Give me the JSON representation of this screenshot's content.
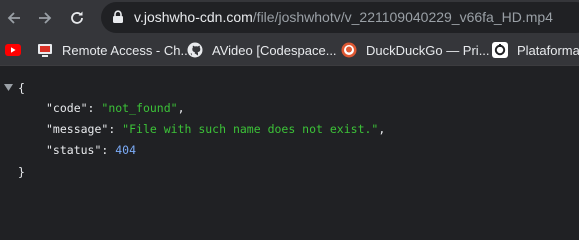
{
  "browser": {
    "url_host": "v.joshwho-cdn.com",
    "url_path": "/file/joshwhotv/v_221109040229_v66fa_HD.mp4"
  },
  "bookmarks": [
    {
      "label": "",
      "icon": "youtube-icon"
    },
    {
      "label": "Remote Access - Ch...",
      "icon": "remote-desktop-icon"
    },
    {
      "label": "AVideo [Codespace...",
      "icon": "github-icon"
    },
    {
      "label": "DuckDuckGo — Pri...",
      "icon": "duckduckgo-icon"
    },
    {
      "label": "Plataforma c",
      "icon": "plataforma-icon"
    }
  ],
  "json_view": {
    "open_brace": "{",
    "close_brace": "}",
    "fields": [
      {
        "key": "\"code\"",
        "value": "\"not_found\"",
        "type": "string",
        "suffix": ","
      },
      {
        "key": "\"message\"",
        "value": "\"File with such name does not exist.\"",
        "type": "string",
        "suffix": ","
      },
      {
        "key": "\"status\"",
        "value": "404",
        "type": "number",
        "suffix": ""
      }
    ]
  }
}
